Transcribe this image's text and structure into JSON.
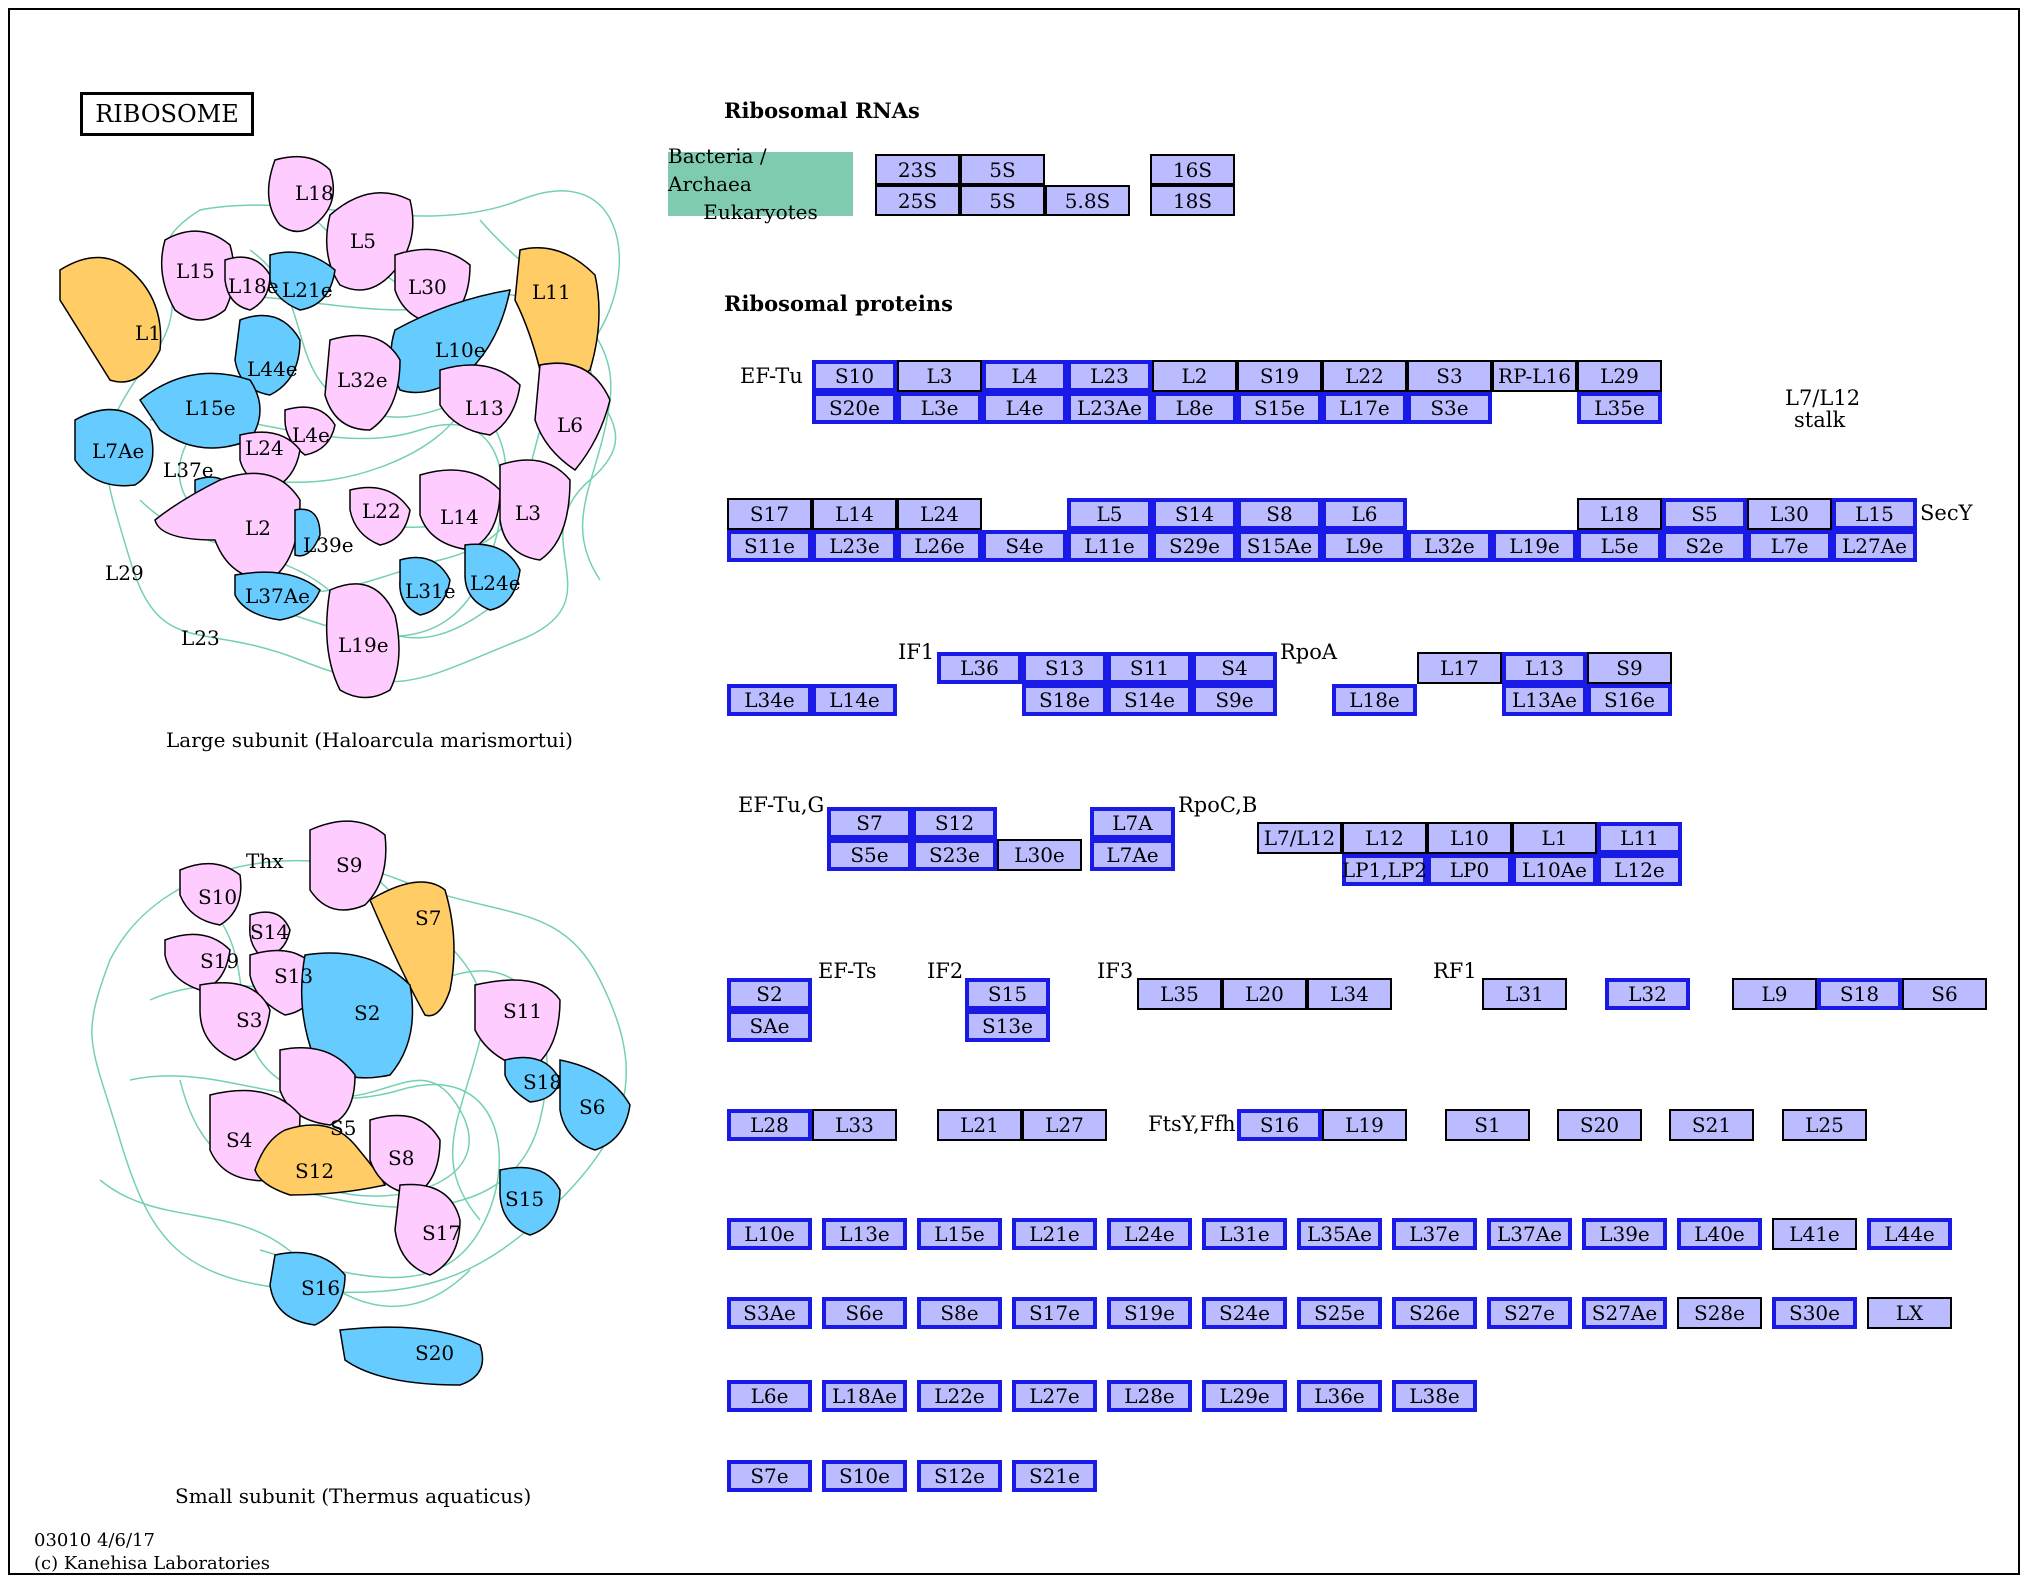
{
  "title": "RIBOSOME",
  "colors": {
    "protein_box": "#bbbbff",
    "highlight_border": "#1a1ae6",
    "pink": "#ffccff",
    "blue": "#66ccff",
    "orange": "#ffcc66",
    "legend_green": "#7fcbb0",
    "rna_strands": "#66ccaa"
  },
  "sections": {
    "rna": "Ribosomal RNAs",
    "proteins": "Ribosomal proteins"
  },
  "legend": {
    "line1": "Bacteria / Archaea",
    "line2": "Eukaryotes"
  },
  "rna_boxes": [
    "23S",
    "5S",
    "16S",
    "25S",
    "5S",
    "5.8S",
    "18S"
  ],
  "large_subunit": {
    "caption": "Large subunit (Haloarcula marismortui)",
    "labels": [
      "L18",
      "L5",
      "L15",
      "L18e",
      "L21e",
      "L30",
      "L11",
      "L1",
      "L10e",
      "L44e",
      "L32e",
      "L15e",
      "L13",
      "L6",
      "L4e",
      "L7Ae",
      "L24",
      "L37e",
      "L22",
      "L14",
      "L3",
      "L2",
      "L39e",
      "L29",
      "L31e",
      "L24e",
      "L37Ae",
      "L23",
      "L19e"
    ]
  },
  "small_subunit": {
    "caption": "Small subunit (Thermus aquaticus)",
    "labels": [
      "Thx",
      "S9",
      "S10",
      "S7",
      "S14",
      "S19",
      "S13",
      "S3",
      "S2",
      "S11",
      "S18",
      "S6",
      "S5",
      "S4",
      "S12",
      "S8",
      "S15",
      "S17",
      "S16",
      "S20"
    ]
  },
  "factor_labels": [
    "EF-Tu",
    "L7/L12",
    "stalk",
    "SecY",
    "IF1",
    "RpoA",
    "EF-Tu,G",
    "RpoC,B",
    "EF-Ts",
    "IF2",
    "IF3",
    "RF1",
    "FtsY,Ffh"
  ],
  "protein_boxes": [
    "S10",
    "L3",
    "L4",
    "L23",
    "L2",
    "S19",
    "L22",
    "S3",
    "RP-L16",
    "L29",
    "S20e",
    "L3e",
    "L4e",
    "L23Ae",
    "L8e",
    "S15e",
    "L17e",
    "S3e",
    "L35e",
    "S17",
    "L14",
    "L24",
    "L5",
    "S14",
    "S8",
    "L6",
    "L18",
    "S5",
    "L30",
    "L15",
    "S11e",
    "L23e",
    "L26e",
    "S4e",
    "L11e",
    "S29e",
    "S15Ae",
    "L9e",
    "L32e",
    "L19e",
    "L5e",
    "S2e",
    "L7e",
    "L27Ae",
    "L36",
    "S13",
    "S11",
    "S4",
    "L17",
    "L13",
    "S9",
    "L34e",
    "L14e",
    "S18e",
    "S14e",
    "S9e",
    "L18e",
    "L13Ae",
    "S16e",
    "S7",
    "S12",
    "L7A",
    "L7/L12",
    "L12",
    "L10",
    "L1",
    "L11",
    "S5e",
    "S23e",
    "L30e",
    "L7Ae",
    "LP1,LP2",
    "LP0",
    "L10Ae",
    "L12e",
    "S2",
    "S15",
    "L35",
    "L20",
    "L34",
    "L31",
    "L32",
    "L9",
    "S18",
    "S6",
    "SAe",
    "S13e",
    "L28",
    "L33",
    "L21",
    "L27",
    "S16",
    "L19",
    "S1",
    "S20",
    "S21",
    "L25",
    "L10e",
    "L13e",
    "L15e",
    "L21e",
    "L24e",
    "L31e",
    "L35Ae",
    "L37e",
    "L37Ae",
    "L39e",
    "L40e",
    "L41e",
    "L44e",
    "S3Ae",
    "S6e",
    "S8e",
    "S17e",
    "S19e",
    "S24e",
    "S25e",
    "S26e",
    "S27e",
    "S27Ae",
    "S28e",
    "S30e",
    "LX",
    "L6e",
    "L18Ae",
    "L22e",
    "L27e",
    "L28e",
    "L29e",
    "L36e",
    "L38e",
    "S7e",
    "S10e",
    "S12e",
    "S21e"
  ],
  "footer": {
    "line1": "03010 4/6/17",
    "line2": "(c) Kanehisa Laboratories"
  }
}
